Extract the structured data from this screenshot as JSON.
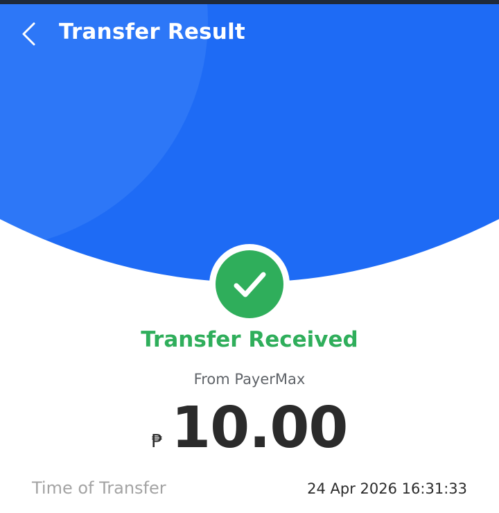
{
  "colors": {
    "primary_blue": "#1E6BF5",
    "highlight_blue": "#3A82F7",
    "success_green": "#2FAE5B",
    "status_bar": "#1F2A3A",
    "label_gray": "#A3A3A3",
    "text_dark": "#2B2B2B"
  },
  "header": {
    "back_icon": "chevron-left-icon",
    "title": "Transfer Result"
  },
  "result": {
    "status_icon": "checkmark-icon",
    "status": "Transfer Received",
    "source": "From PayerMax",
    "currency_symbol": "₱",
    "amount": "10.00"
  },
  "details": [
    {
      "label": "Time of Transfer",
      "value": "24 Apr 2026 16:31:33"
    }
  ]
}
